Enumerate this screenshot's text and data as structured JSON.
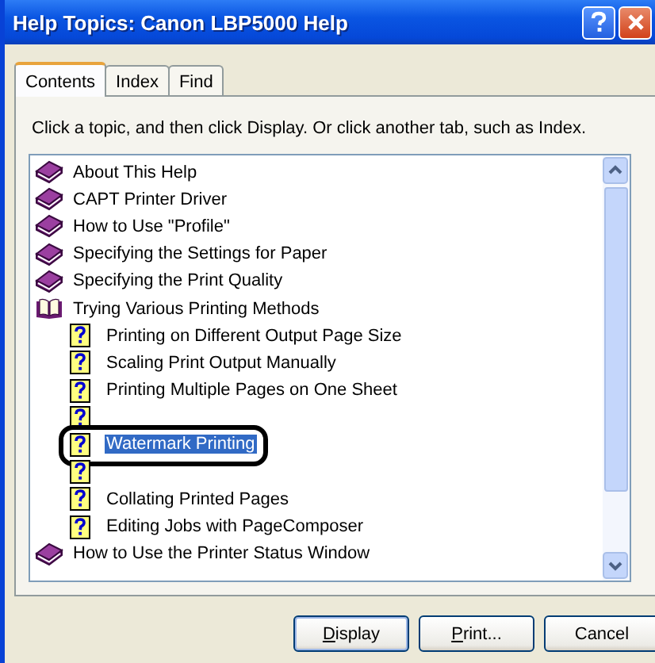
{
  "window": {
    "title": "Help Topics: Canon LBP5000 Help"
  },
  "tabs": [
    {
      "label": "Contents",
      "selected": true
    },
    {
      "label": "Index",
      "selected": false
    },
    {
      "label": "Find",
      "selected": false
    }
  ],
  "instruction": "Click a topic, and then click Display. Or click another tab, such as Index.",
  "tree": [
    {
      "kind": "book",
      "label": "About This Help",
      "expanded": false,
      "selected": false
    },
    {
      "kind": "book",
      "label": "CAPT Printer Driver",
      "expanded": false,
      "selected": false
    },
    {
      "kind": "book",
      "label": "How to Use \"Profile\"",
      "expanded": false,
      "selected": false
    },
    {
      "kind": "book",
      "label": "Specifying the Settings for Paper",
      "expanded": false,
      "selected": false
    },
    {
      "kind": "book",
      "label": "Specifying the Print Quality",
      "expanded": false,
      "selected": false
    },
    {
      "kind": "book",
      "label": "Trying Various Printing Methods",
      "expanded": true,
      "selected": false,
      "children": [
        {
          "kind": "topic",
          "label": "Printing on Different Output Page Size",
          "selected": false
        },
        {
          "kind": "topic",
          "label": "Scaling Print Output Manually",
          "selected": false
        },
        {
          "kind": "topic",
          "label": "Printing Multiple Pages on One Sheet",
          "selected": false
        },
        {
          "kind": "topic",
          "selected": false
        },
        {
          "kind": "topic",
          "label": "Watermark Printing",
          "selected": true,
          "callout": true
        },
        {
          "kind": "topic",
          "selected": false
        },
        {
          "kind": "topic",
          "label": "Collating Printed Pages",
          "selected": false
        },
        {
          "kind": "topic",
          "label": "Editing Jobs with PageComposer",
          "selected": false
        }
      ]
    },
    {
      "kind": "book",
      "label": "How to Use the Printer Status Window",
      "expanded": false,
      "selected": false
    }
  ],
  "buttons": [
    {
      "label": "Display",
      "mnemonic": true,
      "default": true
    },
    {
      "label": "Print...",
      "mnemonic": true,
      "default": false
    },
    {
      "label": "Cancel",
      "mnemonic": false,
      "default": false
    }
  ]
}
